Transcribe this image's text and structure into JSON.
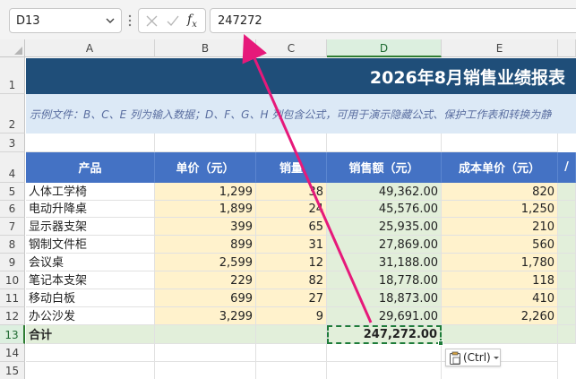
{
  "formula_bar": {
    "name_box": "D13",
    "formula": "247272",
    "fx_label": "f",
    "fx_sub": "x"
  },
  "columns": [
    "A",
    "B",
    "C",
    "D",
    "E"
  ],
  "rows": [
    "1",
    "2",
    "3",
    "4",
    "5",
    "6",
    "7",
    "8",
    "9",
    "10",
    "11",
    "12",
    "13",
    "14",
    "15"
  ],
  "title": "2026年8月销售业绩报表",
  "note": "示例文件：B、C、E 列为输入数据；D、F、G、H 列包含公式，可用于演示隐藏公式、保护工作表和转换为静",
  "headers": {
    "product": "产品",
    "unit_price": "单价（元）",
    "qty": "销量",
    "amount": "销售额（元）",
    "cost": "成本单价（元）",
    "next": "/"
  },
  "table_rows": [
    {
      "product": "人体工学椅",
      "price": "1,299",
      "qty": "38",
      "amount": "49,362.00",
      "cost": "820"
    },
    {
      "product": "电动升降桌",
      "price": "1,899",
      "qty": "24",
      "amount": "45,576.00",
      "cost": "1,250"
    },
    {
      "product": "显示器支架",
      "price": "399",
      "qty": "65",
      "amount": "25,935.00",
      "cost": "210"
    },
    {
      "product": "钢制文件柜",
      "price": "899",
      "qty": "31",
      "amount": "27,869.00",
      "cost": "560"
    },
    {
      "product": "会议桌",
      "price": "2,599",
      "qty": "12",
      "amount": "31,188.00",
      "cost": "1,780"
    },
    {
      "product": "笔记本支架",
      "price": "229",
      "qty": "82",
      "amount": "18,778.00",
      "cost": "118"
    },
    {
      "product": "移动白板",
      "price": "699",
      "qty": "27",
      "amount": "18,873.00",
      "cost": "410"
    },
    {
      "product": "办公沙发",
      "price": "3,299",
      "qty": "9",
      "amount": "29,691.00",
      "cost": "2,260"
    }
  ],
  "total": {
    "label": "合计",
    "amount": "247,272.00"
  },
  "paste_options": "(Ctrl)",
  "colors": {
    "title_bg": "#1f4e79",
    "header_bg": "#4472c4",
    "input_fill": "#fff2cc",
    "calc_fill": "#e2efda",
    "arrow": "#e6197a"
  }
}
